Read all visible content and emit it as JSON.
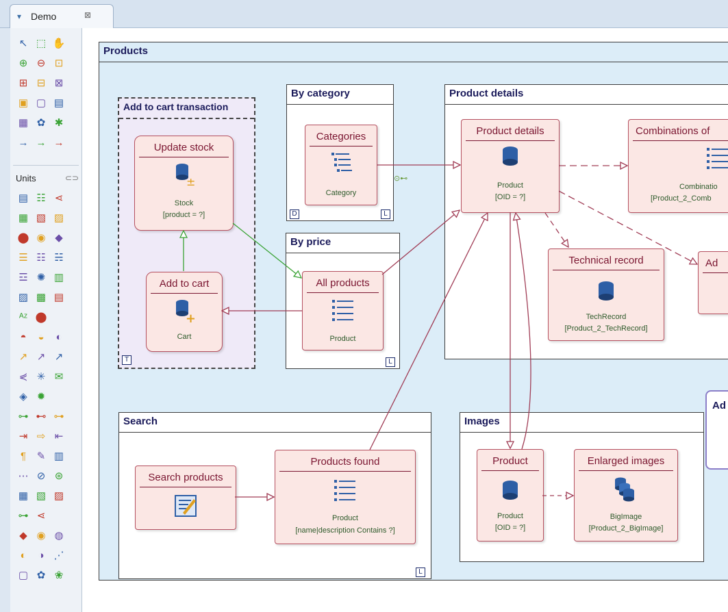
{
  "tab": {
    "label": "Demo",
    "close": "⊠"
  },
  "palette": {
    "units_label": "Units",
    "rows_top": [
      [
        "↖",
        "⬚",
        "✋"
      ],
      [
        "⊕",
        "⊖",
        "⊡"
      ],
      [
        "⊞",
        "⊟",
        "⊠"
      ],
      [
        "▣",
        "▢",
        "▤"
      ],
      [
        "▦",
        "✿",
        "✱"
      ],
      [
        "→",
        "→",
        "→"
      ]
    ],
    "rows_units": [
      [
        "▤",
        "☷",
        "⋖"
      ],
      [
        "▦",
        "▧",
        "▨"
      ],
      [
        "⬤",
        "◉",
        "◆"
      ],
      [
        "☰",
        "☷",
        "☵"
      ],
      [
        "☲",
        "✺",
        "▥"
      ],
      [
        "▨",
        "▩",
        "▤"
      ],
      [
        "ᴬᶻ",
        "⬤",
        ""
      ],
      [
        "◓",
        "◒",
        "◐"
      ],
      [
        "↗",
        "↗",
        "↗"
      ],
      [
        "⋞",
        "✳",
        "✉"
      ],
      [
        "◈",
        "✹",
        ""
      ],
      [
        "⊶",
        "⊷",
        "⊶"
      ],
      [
        "⇥",
        "⇨",
        "⇤"
      ],
      [
        "¶",
        "✎",
        "▥"
      ],
      [
        "⋯",
        "⊘",
        "⊛"
      ],
      [
        "▦",
        "▧",
        "▨"
      ],
      [
        "⊶",
        "⋖",
        ""
      ],
      [
        "◆",
        "◉",
        "◍"
      ],
      [
        "◐",
        "◑",
        "⋰"
      ],
      [
        "▢",
        "✿",
        "❀"
      ]
    ]
  },
  "colors": {
    "accent": "#7a1530",
    "link": "#a03c55",
    "green": "#3aa335",
    "title": "#1a1a5a"
  },
  "diagram": {
    "products_area": {
      "title": "Products"
    },
    "add_to_cart_txn": {
      "title": "Add to cart transaction",
      "badge": "T"
    },
    "by_category": {
      "title": "By category",
      "badge_left": "D",
      "badge_right": "L"
    },
    "by_price": {
      "title": "By price",
      "badge": "L"
    },
    "product_details_area": {
      "title": "Product details"
    },
    "search_area": {
      "title": "Search",
      "badge": "L"
    },
    "images_area": {
      "title": "Images"
    },
    "partial_area": {
      "title": "Ad"
    },
    "units": {
      "update_stock": {
        "title": "Update stock",
        "icon": "db-plus-minus-icon",
        "l1": "Stock",
        "l2": "[product = ?]"
      },
      "add_to_cart": {
        "title": "Add to cart",
        "icon": "db-plus-icon",
        "l1": "Cart"
      },
      "categories": {
        "title": "Categories",
        "icon": "tree-list-icon",
        "l1": "Category"
      },
      "all_products": {
        "title": "All products",
        "icon": "list-icon",
        "l1": "Product"
      },
      "product_details": {
        "title": "Product details",
        "icon": "database-icon",
        "l1": "Product",
        "l2": "[OID = ?]"
      },
      "combinations": {
        "title": "Combinations of",
        "icon": "list-icon",
        "l1": "Combinatio",
        "l2": "[Product_2_Comb"
      },
      "technical_record": {
        "title": "Technical record",
        "icon": "database-icon",
        "l1": "TechRecord",
        "l2": "[Product_2_TechRecord]"
      },
      "partial_right": {
        "title": "Ad"
      },
      "search_products": {
        "title": "Search products",
        "icon": "form-icon"
      },
      "products_found": {
        "title": "Products found",
        "icon": "list-icon",
        "l1": "Product",
        "l2": "[name|description Contains ?]"
      },
      "image_product": {
        "title": "Product",
        "icon": "database-icon",
        "l1": "Product",
        "l2": "[OID = ?]"
      },
      "enlarged_images": {
        "title": "Enlarged images",
        "icon": "multi-database-icon",
        "l1": "BigImage",
        "l2": "[Product_2_BigImage]"
      }
    },
    "link_marker": "⊙⊷"
  }
}
